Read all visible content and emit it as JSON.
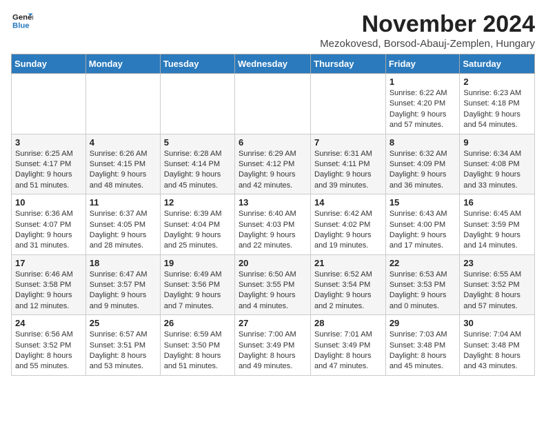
{
  "logo": {
    "line1": "General",
    "line2": "Blue"
  },
  "title": "November 2024",
  "subtitle": "Mezokovesd, Borsod-Abauj-Zemplen, Hungary",
  "headers": [
    "Sunday",
    "Monday",
    "Tuesday",
    "Wednesday",
    "Thursday",
    "Friday",
    "Saturday"
  ],
  "weeks": [
    [
      {
        "day": "",
        "info": ""
      },
      {
        "day": "",
        "info": ""
      },
      {
        "day": "",
        "info": ""
      },
      {
        "day": "",
        "info": ""
      },
      {
        "day": "",
        "info": ""
      },
      {
        "day": "1",
        "info": "Sunrise: 6:22 AM\nSunset: 4:20 PM\nDaylight: 9 hours and 57 minutes."
      },
      {
        "day": "2",
        "info": "Sunrise: 6:23 AM\nSunset: 4:18 PM\nDaylight: 9 hours and 54 minutes."
      }
    ],
    [
      {
        "day": "3",
        "info": "Sunrise: 6:25 AM\nSunset: 4:17 PM\nDaylight: 9 hours and 51 minutes."
      },
      {
        "day": "4",
        "info": "Sunrise: 6:26 AM\nSunset: 4:15 PM\nDaylight: 9 hours and 48 minutes."
      },
      {
        "day": "5",
        "info": "Sunrise: 6:28 AM\nSunset: 4:14 PM\nDaylight: 9 hours and 45 minutes."
      },
      {
        "day": "6",
        "info": "Sunrise: 6:29 AM\nSunset: 4:12 PM\nDaylight: 9 hours and 42 minutes."
      },
      {
        "day": "7",
        "info": "Sunrise: 6:31 AM\nSunset: 4:11 PM\nDaylight: 9 hours and 39 minutes."
      },
      {
        "day": "8",
        "info": "Sunrise: 6:32 AM\nSunset: 4:09 PM\nDaylight: 9 hours and 36 minutes."
      },
      {
        "day": "9",
        "info": "Sunrise: 6:34 AM\nSunset: 4:08 PM\nDaylight: 9 hours and 33 minutes."
      }
    ],
    [
      {
        "day": "10",
        "info": "Sunrise: 6:36 AM\nSunset: 4:07 PM\nDaylight: 9 hours and 31 minutes."
      },
      {
        "day": "11",
        "info": "Sunrise: 6:37 AM\nSunset: 4:05 PM\nDaylight: 9 hours and 28 minutes."
      },
      {
        "day": "12",
        "info": "Sunrise: 6:39 AM\nSunset: 4:04 PM\nDaylight: 9 hours and 25 minutes."
      },
      {
        "day": "13",
        "info": "Sunrise: 6:40 AM\nSunset: 4:03 PM\nDaylight: 9 hours and 22 minutes."
      },
      {
        "day": "14",
        "info": "Sunrise: 6:42 AM\nSunset: 4:02 PM\nDaylight: 9 hours and 19 minutes."
      },
      {
        "day": "15",
        "info": "Sunrise: 6:43 AM\nSunset: 4:00 PM\nDaylight: 9 hours and 17 minutes."
      },
      {
        "day": "16",
        "info": "Sunrise: 6:45 AM\nSunset: 3:59 PM\nDaylight: 9 hours and 14 minutes."
      }
    ],
    [
      {
        "day": "17",
        "info": "Sunrise: 6:46 AM\nSunset: 3:58 PM\nDaylight: 9 hours and 12 minutes."
      },
      {
        "day": "18",
        "info": "Sunrise: 6:47 AM\nSunset: 3:57 PM\nDaylight: 9 hours and 9 minutes."
      },
      {
        "day": "19",
        "info": "Sunrise: 6:49 AM\nSunset: 3:56 PM\nDaylight: 9 hours and 7 minutes."
      },
      {
        "day": "20",
        "info": "Sunrise: 6:50 AM\nSunset: 3:55 PM\nDaylight: 9 hours and 4 minutes."
      },
      {
        "day": "21",
        "info": "Sunrise: 6:52 AM\nSunset: 3:54 PM\nDaylight: 9 hours and 2 minutes."
      },
      {
        "day": "22",
        "info": "Sunrise: 6:53 AM\nSunset: 3:53 PM\nDaylight: 9 hours and 0 minutes."
      },
      {
        "day": "23",
        "info": "Sunrise: 6:55 AM\nSunset: 3:52 PM\nDaylight: 8 hours and 57 minutes."
      }
    ],
    [
      {
        "day": "24",
        "info": "Sunrise: 6:56 AM\nSunset: 3:52 PM\nDaylight: 8 hours and 55 minutes."
      },
      {
        "day": "25",
        "info": "Sunrise: 6:57 AM\nSunset: 3:51 PM\nDaylight: 8 hours and 53 minutes."
      },
      {
        "day": "26",
        "info": "Sunrise: 6:59 AM\nSunset: 3:50 PM\nDaylight: 8 hours and 51 minutes."
      },
      {
        "day": "27",
        "info": "Sunrise: 7:00 AM\nSunset: 3:49 PM\nDaylight: 8 hours and 49 minutes."
      },
      {
        "day": "28",
        "info": "Sunrise: 7:01 AM\nSunset: 3:49 PM\nDaylight: 8 hours and 47 minutes."
      },
      {
        "day": "29",
        "info": "Sunrise: 7:03 AM\nSunset: 3:48 PM\nDaylight: 8 hours and 45 minutes."
      },
      {
        "day": "30",
        "info": "Sunrise: 7:04 AM\nSunset: 3:48 PM\nDaylight: 8 hours and 43 minutes."
      }
    ]
  ]
}
